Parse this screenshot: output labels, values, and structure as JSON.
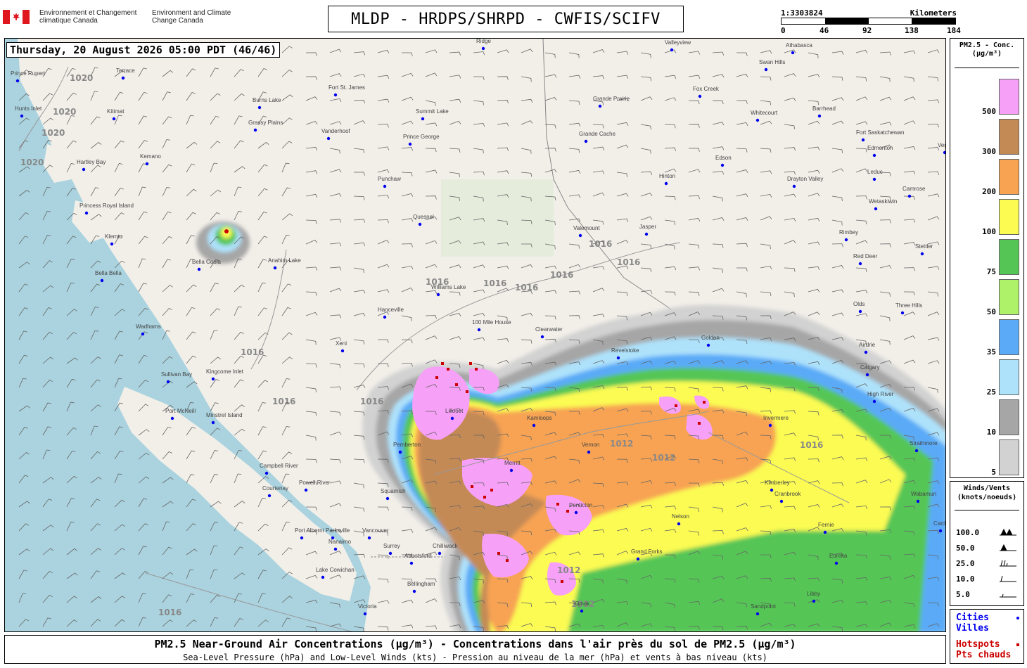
{
  "header": {
    "agency_fr": "Environnement et Changement climatique Canada",
    "agency_en": "Environment and Climate Change Canada",
    "title": "MLDP - HRDPS/SHRPD - CWFIS/SCIFV",
    "scale_ratio": "1:3303824",
    "scale_unit": "Kilometers",
    "scale_ticks": [
      "0",
      "46",
      "92",
      "138",
      "184"
    ]
  },
  "timestamp": "Thursday, 20 August 2026 05:00 PDT (46/46)",
  "legend": {
    "title_line1": "PM2.5 - Conc.",
    "title_line2": "(μg/m³)",
    "bins": [
      {
        "label": "500",
        "color": "#f7a0f7"
      },
      {
        "label": "300",
        "color": "#c48a56"
      },
      {
        "label": "200",
        "color": "#f7a352"
      },
      {
        "label": "100",
        "color": "#fbfb52"
      },
      {
        "label": "75",
        "color": "#55c656"
      },
      {
        "label": "50",
        "color": "#aef26a"
      },
      {
        "label": "35",
        "color": "#5aaaf7"
      },
      {
        "label": "25",
        "color": "#aee2fb"
      },
      {
        "label": "10",
        "color": "#a6a6a6"
      },
      {
        "label": "5",
        "color": "#d2d2d2"
      }
    ]
  },
  "winds_legend": {
    "title_line1": "Winds/Vents",
    "title_line2": "(knots/noeuds)",
    "rows": [
      "100.0",
      "50.0",
      "25.0",
      "10.0",
      "5.0"
    ]
  },
  "cities_legend": {
    "cities_en": "Cities",
    "cities_fr": "Villes",
    "hotspots_en": "Hotspots",
    "hotspots_fr": "Pts chauds",
    "city_color": "#0000ee",
    "hotspot_color": "#cc0000"
  },
  "footer": {
    "line1": "PM2.5 Near-Ground Air Concentrations (μg/m³) - Concentrations dans l'air près du sol de PM2.5 (μg/m³)",
    "line2": "Sea-Level Pressure (hPa) and Low-Level Winds (kts) - Pression au niveau de la mer (hPa) et vents à bas niveau (kts)"
  },
  "map": {
    "isobars": [
      "1020",
      "1020",
      "1020",
      "1020",
      "1016",
      "1016",
      "1016",
      "1016",
      "1016",
      "1016",
      "1016",
      "1016",
      "1016",
      "1016",
      "1012",
      "1012",
      "1012",
      "1012",
      "1016"
    ],
    "places": [
      {
        "name": "Prince Rupert"
      },
      {
        "name": "Terrace"
      },
      {
        "name": "Kitimat"
      },
      {
        "name": "Hunts Inlet"
      },
      {
        "name": "Kemano"
      },
      {
        "name": "Hartley Bay"
      },
      {
        "name": "Princess Royal Island"
      },
      {
        "name": "Klemtu"
      },
      {
        "name": "Bella Bella"
      },
      {
        "name": "Bella Coola"
      },
      {
        "name": "Anahim Lake"
      },
      {
        "name": "Wadhams"
      },
      {
        "name": "Sullivan Bay"
      },
      {
        "name": "Kingcome Inlet"
      },
      {
        "name": "Port McNeill"
      },
      {
        "name": "Minstrel Island"
      },
      {
        "name": "Campbell River"
      },
      {
        "name": "Courtenay"
      },
      {
        "name": "Powell River"
      },
      {
        "name": "Port Alberni"
      },
      {
        "name": "Parksville"
      },
      {
        "name": "Nanaimo"
      },
      {
        "name": "Lake Cowichan"
      },
      {
        "name": "Victoria"
      },
      {
        "name": "Vancouver"
      },
      {
        "name": "Surrey"
      },
      {
        "name": "Abbotsford"
      },
      {
        "name": "Chilliwack"
      },
      {
        "name": "Bellingham"
      },
      {
        "name": "Squamish"
      },
      {
        "name": "Pemberton"
      },
      {
        "name": "Lillooet"
      },
      {
        "name": "Merritt"
      },
      {
        "name": "Kamloops"
      },
      {
        "name": "Vernon"
      },
      {
        "name": "Penticton"
      },
      {
        "name": "Hanceville"
      },
      {
        "name": "Williams Lake"
      },
      {
        "name": "100 Mile House"
      },
      {
        "name": "Clearwater"
      },
      {
        "name": "Quesnel"
      },
      {
        "name": "Prince George"
      },
      {
        "name": "Vanderhoof"
      },
      {
        "name": "Fort St. James"
      },
      {
        "name": "Burns Lake"
      },
      {
        "name": "Grassy Plains"
      },
      {
        "name": "Summit Lake"
      },
      {
        "name": "Grande Cache"
      },
      {
        "name": "Grande Prairie"
      },
      {
        "name": "Valleyview"
      },
      {
        "name": "Ridge"
      },
      {
        "name": "Valemount"
      },
      {
        "name": "Jasper"
      },
      {
        "name": "Hinton"
      },
      {
        "name": "Edson"
      },
      {
        "name": "Whitecourt"
      },
      {
        "name": "Fox Creek"
      },
      {
        "name": "Swan Hills"
      },
      {
        "name": "Athabasca"
      },
      {
        "name": "Barrhead"
      },
      {
        "name": "Fort Saskatchewan"
      },
      {
        "name": "Edmonton"
      },
      {
        "name": "Leduc"
      },
      {
        "name": "Camrose"
      },
      {
        "name": "Wetaskiwin"
      },
      {
        "name": "Drayton Valley"
      },
      {
        "name": "Rimbey"
      },
      {
        "name": "Red Deer"
      },
      {
        "name": "Stettler"
      },
      {
        "name": "Olds"
      },
      {
        "name": "Three Hills"
      },
      {
        "name": "Airdrie"
      },
      {
        "name": "Calgary"
      },
      {
        "name": "High River"
      },
      {
        "name": "Strathmore"
      },
      {
        "name": "Invermere"
      },
      {
        "name": "Golden"
      },
      {
        "name": "Revelstoke"
      },
      {
        "name": "Nelson"
      },
      {
        "name": "Cranbrook"
      },
      {
        "name": "Kimberley"
      },
      {
        "name": "Fernie"
      },
      {
        "name": "Grand Forks"
      },
      {
        "name": "Omak"
      },
      {
        "name": "Sandpoint"
      },
      {
        "name": "Libby"
      },
      {
        "name": "Eureka"
      },
      {
        "name": "Cardston"
      },
      {
        "name": "Xeni"
      },
      {
        "name": "Punchaw"
      },
      {
        "name": "Vegreville"
      },
      {
        "name": "Wabamun"
      }
    ]
  }
}
